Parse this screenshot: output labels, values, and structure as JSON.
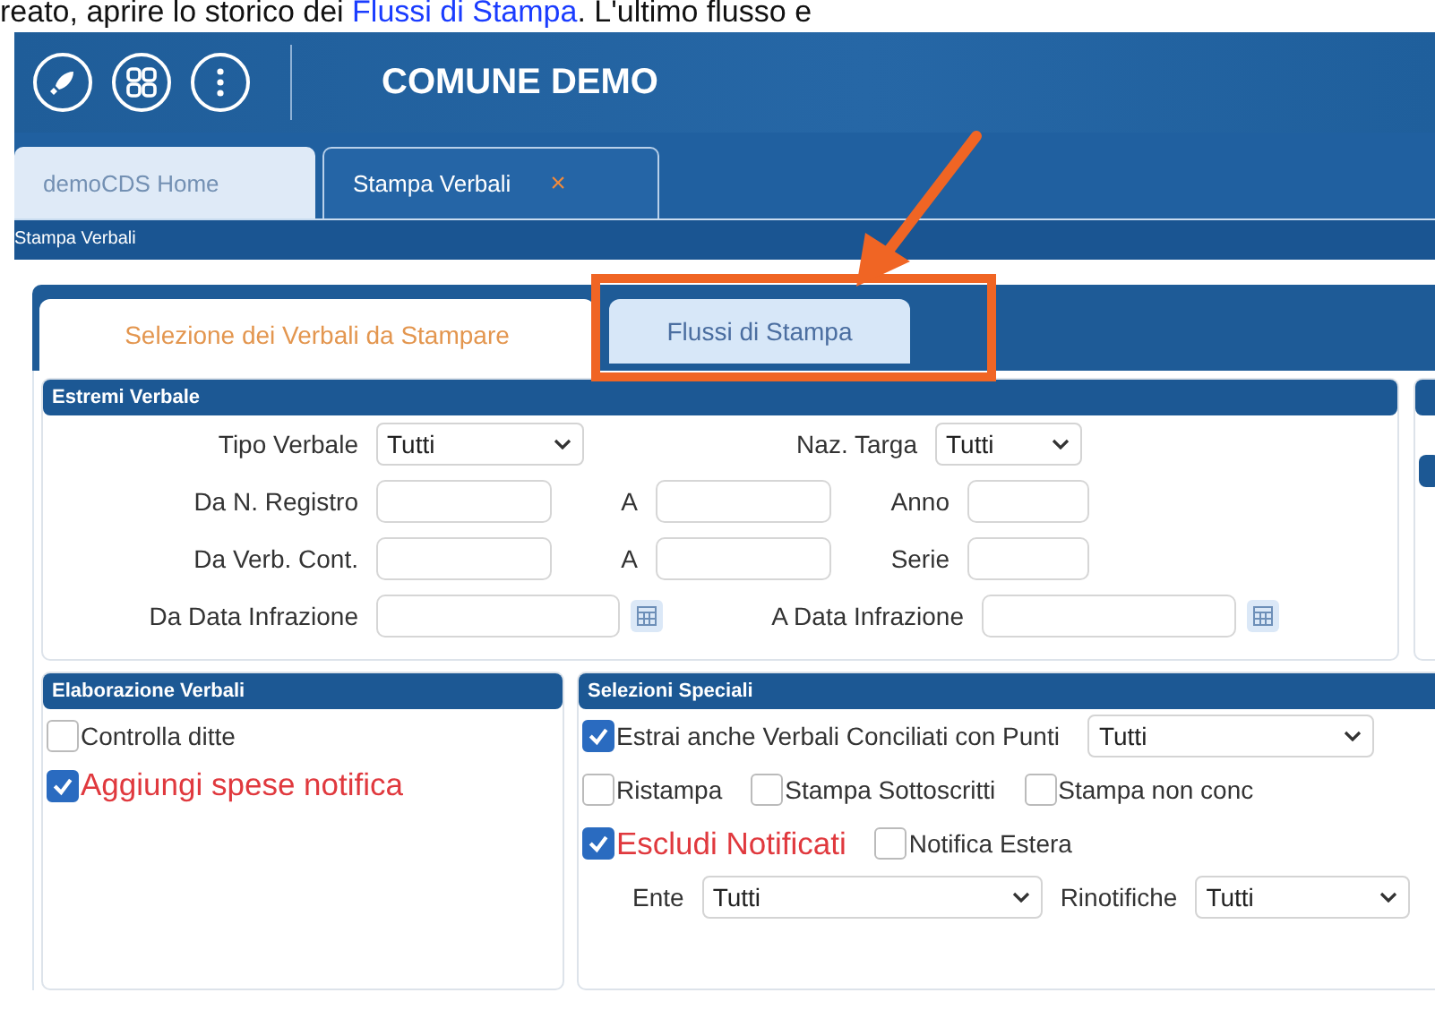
{
  "doc_line": {
    "parts": [
      {
        "kind": "plain",
        "text": "reato, aprire lo storico dei "
      },
      {
        "kind": "link",
        "text": "Flussi di Stampa"
      },
      {
        "kind": "plain",
        "text": ". L'ultimo flusso e"
      }
    ]
  },
  "header": {
    "title": "COMUNE DEMO"
  },
  "app_tabs": [
    {
      "label": "demoCDS Home",
      "selected": false
    },
    {
      "label": "Stampa Verbali",
      "selected": true,
      "close": "×"
    }
  ],
  "breadcrumb": "Stampa Verbali",
  "inner_tabs": [
    {
      "label": "Selezione dei Verbali da Stampare",
      "selected": true
    },
    {
      "label": "Flussi di Stampa",
      "selected": false
    }
  ],
  "estremi_verbale": {
    "title": "Estremi Verbale",
    "rows": [
      [
        {
          "label": "Tipo Verbale",
          "kind": "select",
          "value": "Tutti"
        },
        {
          "label": "Naz. Targa",
          "kind": "select",
          "value": "Tutti"
        }
      ],
      [
        {
          "label": "Da N. Registro",
          "kind": "text"
        },
        {
          "label": "A",
          "kind": "text"
        },
        {
          "label": "Anno",
          "kind": "text"
        }
      ],
      [
        {
          "label": "Da Verb. Cont.",
          "kind": "text"
        },
        {
          "label": "A",
          "kind": "text"
        },
        {
          "label": "Serie",
          "kind": "text"
        }
      ],
      [
        {
          "label": "Da Data Infrazione",
          "kind": "date"
        },
        {
          "label": "A Data Infrazione",
          "kind": "date"
        }
      ]
    ]
  },
  "elaborazione_verbali": {
    "title": "Elaborazione Verbali",
    "items": [
      {
        "kind": "checkbox",
        "label": "Controlla ditte",
        "checked": false,
        "emphasis": false
      },
      {
        "kind": "checkbox",
        "label": "Aggiungi spese notifica",
        "checked": true,
        "emphasis": true
      }
    ]
  },
  "selezioni_speciali": {
    "title": "Selezioni Speciali",
    "rows": [
      [
        {
          "kind": "checkbox",
          "label": "Estrai anche Verbali Conciliati con Punti",
          "checked": true,
          "emphasis": false
        },
        {
          "kind": "select",
          "value": "Tutti"
        }
      ],
      [
        {
          "kind": "checkbox",
          "label": "Ristampa",
          "checked": false,
          "emphasis": false
        },
        {
          "kind": "checkbox",
          "label": "Stampa Sottoscritti",
          "checked": false,
          "emphasis": false
        },
        {
          "kind": "checkbox",
          "label": "Stampa non conc",
          "checked": false,
          "emphasis": false
        }
      ],
      [
        {
          "kind": "checkbox",
          "label": "Escludi Notificati",
          "checked": true,
          "emphasis": true
        },
        {
          "kind": "checkbox",
          "label": "Notifica Estera",
          "checked": false,
          "emphasis": false
        }
      ],
      [
        {
          "kind": "select",
          "label": "Ente",
          "value": "Tutti"
        },
        {
          "kind": "select",
          "label": "Rinotifiche",
          "value": "Tutti"
        }
      ]
    ]
  }
}
